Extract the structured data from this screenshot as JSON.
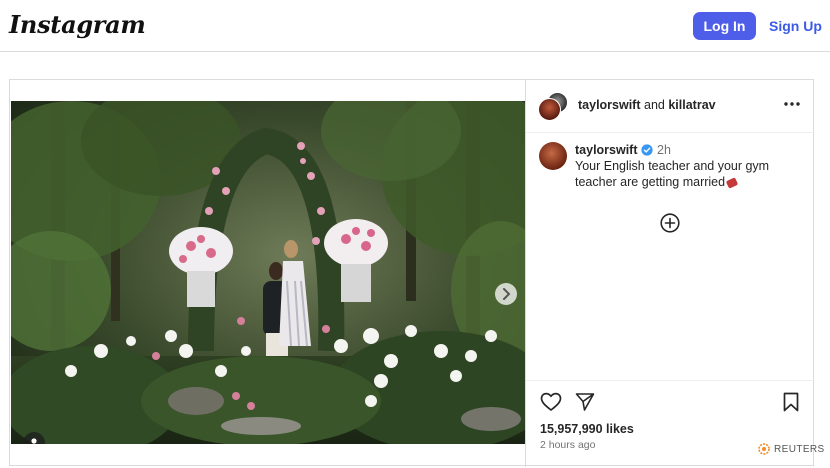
{
  "header": {
    "logo": "Instagram",
    "login_label": "Log In",
    "signup_label": "Sign Up"
  },
  "post": {
    "author_primary": "taylorswift",
    "author_conjunction": "and",
    "author_collab": "killatrav",
    "caption": {
      "username": "taylorswift",
      "time": "2h",
      "text": "Your English teacher and your gym teacher are getting married"
    },
    "likes": "15,957,990 likes",
    "posted": "2 hours ago"
  },
  "icons": {
    "more": "more-options-icon",
    "add": "add-comment-icon",
    "like": "heart-icon",
    "share": "paper-plane-icon",
    "save": "bookmark-icon",
    "verified": "verified-badge-icon",
    "next": "chevron-right-icon",
    "user_tag": "user-tag-icon"
  },
  "colors": {
    "primary_button": "#4f5ee8",
    "link": "#3b5be6",
    "verified": "#3897f0"
  },
  "watermark": {
    "label": "REUTERS"
  }
}
